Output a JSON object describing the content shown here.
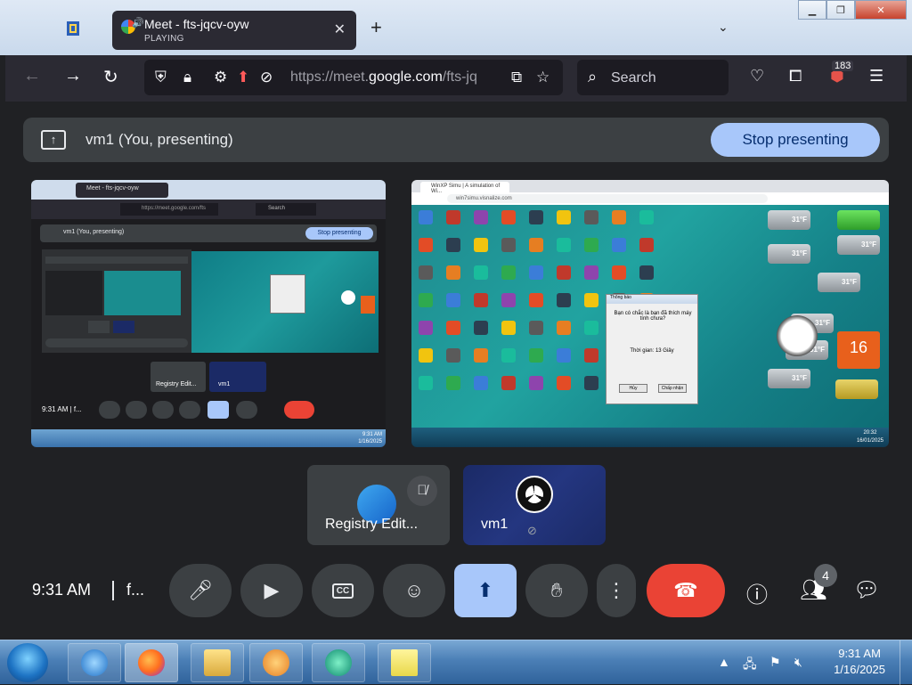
{
  "browser": {
    "tab_title": "Meet - fts-jqcv-oyw",
    "tab_status": "PLAYING",
    "url_host_prefix": "https://meet.",
    "url_host": "google.com",
    "url_path": "/fts-jq",
    "search_placeholder": "Search",
    "extension_badge": "183"
  },
  "meet": {
    "presenting_label": "vm1 (You, presenting)",
    "stop_presenting": "Stop presenting",
    "mini": {
      "tab_title": "Meet - fts-jqcv-oyw",
      "url": "https://meet.google.com/fts",
      "search": "Search",
      "presenting_label": "vm1 (You, presenting)",
      "stop_presenting": "Stop presenting",
      "participant_1": "Registry Edit...",
      "participant_2": "vm1",
      "time": "9:31 AM",
      "code": "f...",
      "clock_time": "9:31 AM",
      "clock_date": "1/16/2025"
    },
    "remote": {
      "tab_title": "WinXP Simu | A simulation of Wi...",
      "url": "win7simu.visnalize.com",
      "dialog_title": "Thông báo",
      "dialog_message": "Bạn có chắc là bạn đã thích máy tính chưa?",
      "dialog_time": "Thời gian: 13 Giây",
      "dialog_btn_1": "Hủy",
      "dialog_btn_2": "Chấp nhận",
      "weather": "31°F",
      "calendar_day": "16",
      "clock_time": "20:32",
      "clock_date": "16/01/2025"
    },
    "participants": [
      {
        "name": "Registry Edit..."
      },
      {
        "name": "vm1"
      }
    ],
    "controls": {
      "time": "9:31 AM",
      "meeting_code": "f...",
      "people_count": "4"
    }
  },
  "taskbar": {
    "time": "9:31 AM",
    "date": "1/16/2025"
  }
}
